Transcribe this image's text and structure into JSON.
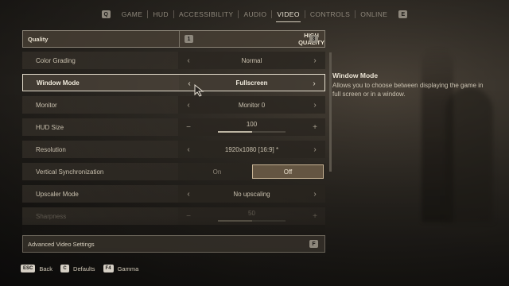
{
  "nav": {
    "left_key": "Q",
    "right_key": "E",
    "tabs": [
      {
        "label": "GAME",
        "active": false
      },
      {
        "label": "HUD",
        "active": false
      },
      {
        "label": "ACCESSIBILITY",
        "active": false
      },
      {
        "label": "AUDIO",
        "active": false
      },
      {
        "label": "VIDEO",
        "active": true
      },
      {
        "label": "CONTROLS",
        "active": false
      },
      {
        "label": "ONLINE",
        "active": false
      }
    ]
  },
  "quality": {
    "label": "Quality",
    "value": "HIGH QUALITY",
    "prev_key": "1",
    "next_key": "3"
  },
  "rows": [
    {
      "label": "Color Grading",
      "value": "Normal"
    },
    {
      "label": "Window Mode",
      "value": "Fullscreen"
    },
    {
      "label": "Monitor",
      "value": "Monitor 0"
    },
    {
      "label": "HUD Size",
      "value": "100",
      "minus": "−",
      "plus": "+",
      "fill": 0.5
    },
    {
      "label": "Resolution",
      "value": "1920x1080 [16:9] *"
    },
    {
      "label": "Vertical Synchronization",
      "on_label": "On",
      "off_label": "Off",
      "selected": "Off"
    },
    {
      "label": "Upscaler Mode",
      "value": "No upscaling"
    },
    {
      "label": "Sharpness",
      "value": "50",
      "minus": "−",
      "plus": "+",
      "fill": 0.5
    }
  ],
  "advanced": {
    "label": "Advanced Video Settings",
    "key": "F"
  },
  "description": {
    "title": "Window Mode",
    "text": "Allows you to choose between displaying the game in full screen or in a window."
  },
  "footer": [
    {
      "key": "ESC",
      "label": "Back"
    },
    {
      "key": "C",
      "label": "Defaults"
    },
    {
      "key": "F4",
      "label": "Gamma"
    }
  ],
  "arrows": {
    "left": "‹",
    "right": "›"
  }
}
